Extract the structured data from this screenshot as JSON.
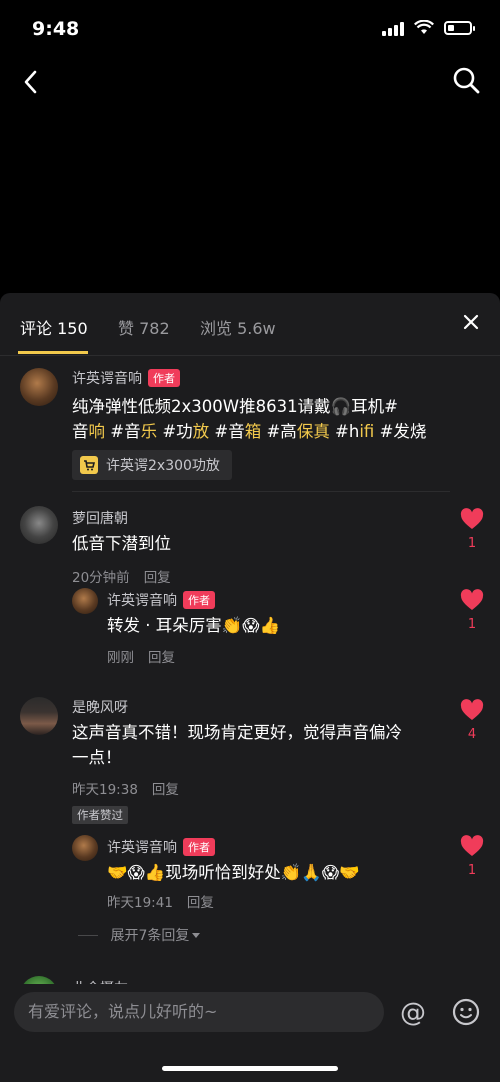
{
  "status_bar": {
    "time": "9:48"
  },
  "tabs": [
    {
      "label": "评论 150",
      "active": true
    },
    {
      "label": "赞 782",
      "active": false
    },
    {
      "label": "浏览 5.6w",
      "active": false
    }
  ],
  "comments": [
    {
      "name": "许英谔音响",
      "author_tag": "作者",
      "text_line1": "纯净弹性低频2x300W推8631请戴🎧耳机#",
      "text_line2_parts": [
        "音",
        "响",
        " #音",
        "乐",
        " #功",
        "放",
        " #音",
        "箱",
        " #高",
        "保真",
        " #h",
        "ifi",
        " #发烧"
      ],
      "card": "许英谔2x300功放"
    },
    {
      "name": "萝回唐朝",
      "text": "低音下潜到位",
      "time": "20分钟前",
      "reply": "回复",
      "likes": "1",
      "replies": [
        {
          "name": "许英谔音响",
          "author_tag": "作者",
          "text": "转发 · 耳朵厉害👏😱👍",
          "time": "刚刚",
          "reply": "回复",
          "likes": "1"
        }
      ]
    },
    {
      "name": "是晚风呀",
      "text_line1": "这声音真不错！现场肯定更好，觉得声音偏冷",
      "text_line2": "一点！",
      "time": "昨天19:38",
      "reply": "回复",
      "liked_badge": "作者赞过",
      "likes": "4",
      "replies": [
        {
          "name": "许英谔音响",
          "author_tag": "作者",
          "text": "🤝😱👍现场听恰到好处👏🙏😱🤝",
          "time": "昨天19:41",
          "reply": "回复",
          "likes": "1"
        }
      ],
      "expand": "展开7条回复"
    },
    {
      "name": "业余摄友"
    }
  ],
  "input": {
    "placeholder": "有爱评论，说点儿好听的~"
  },
  "colors": {
    "accent_yellow": "#f2c94c",
    "like_red": "#f03c5a",
    "sheet_bg": "#1c1c1e"
  }
}
